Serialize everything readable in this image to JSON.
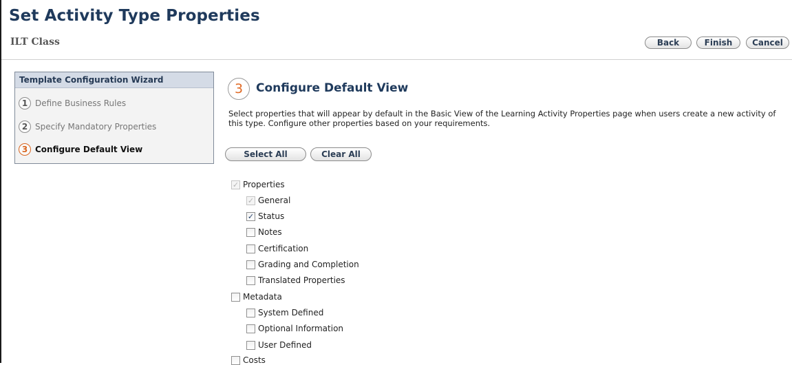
{
  "page": {
    "title": "Set Activity Type Properties",
    "subtitle": "ILT Class"
  },
  "actions": {
    "back": "Back",
    "finish": "Finish",
    "cancel": "Cancel"
  },
  "wizard": {
    "header": "Template Configuration Wizard",
    "steps": [
      {
        "number": "1",
        "label": "Define Business Rules",
        "active": false
      },
      {
        "number": "2",
        "label": "Specify Mandatory Properties",
        "active": false
      },
      {
        "number": "3",
        "label": "Configure Default View",
        "active": true
      }
    ]
  },
  "section": {
    "number": "3",
    "title": "Configure Default View",
    "description": "Select properties that will appear by default in the Basic View of the Learning Activity Properties page when users create a new activity of this type. Configure other properties based on your requirements."
  },
  "selection": {
    "select_all": "Select All",
    "clear_all": "Clear All"
  },
  "tree": {
    "properties": {
      "label": "Properties",
      "checked": true,
      "disabled": true
    },
    "general": {
      "label": "General",
      "checked": true,
      "disabled": true
    },
    "status": {
      "label": "Status",
      "checked": true,
      "disabled": false
    },
    "notes": {
      "label": "Notes",
      "checked": false,
      "disabled": false
    },
    "certification": {
      "label": "Certification",
      "checked": false,
      "disabled": false
    },
    "grading": {
      "label": "Grading and Completion",
      "checked": false,
      "disabled": false
    },
    "translated": {
      "label": "Translated Properties",
      "checked": false,
      "disabled": false
    },
    "metadata": {
      "label": "Metadata",
      "checked": false,
      "disabled": false
    },
    "system_defined": {
      "label": "System Defined",
      "checked": false,
      "disabled": false
    },
    "optional_info": {
      "label": "Optional Information",
      "checked": false,
      "disabled": false
    },
    "user_defined": {
      "label": "User Defined",
      "checked": false,
      "disabled": false
    },
    "costs": {
      "label": "Costs",
      "checked": false,
      "disabled": false
    }
  },
  "colors": {
    "title": "#1f3a5c",
    "accent": "#e06a25",
    "checkmark": "#24416b"
  }
}
